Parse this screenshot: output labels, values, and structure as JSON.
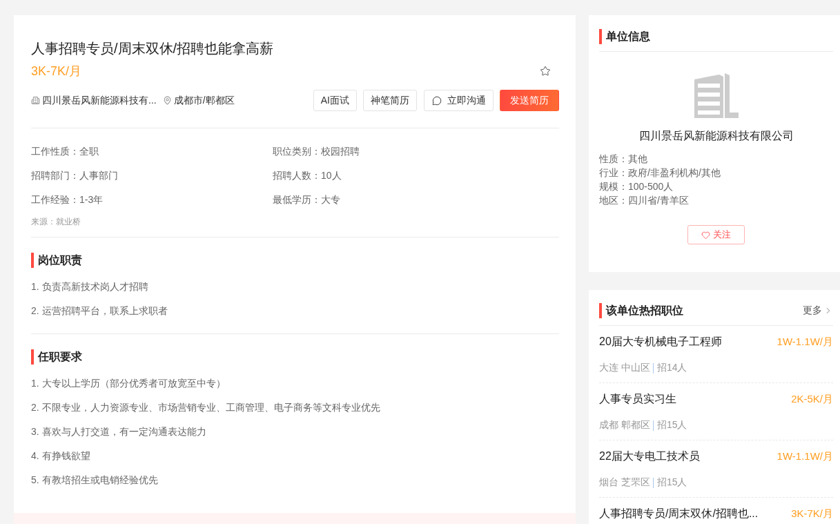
{
  "job": {
    "title": "人事招聘专员/周末双休/招聘也能拿高薪",
    "salary": "3K-7K/月",
    "favorited": false,
    "company": "四川景岳风新能源科技有...",
    "location": "成都市/郫都区",
    "actions": [
      {
        "label": "AI面试",
        "kind": "plain"
      },
      {
        "label": "神笔简历",
        "kind": "plain"
      },
      {
        "label": "立即沟通",
        "kind": "chat"
      },
      {
        "label": "发送简历",
        "kind": "primary"
      }
    ]
  },
  "details": [
    "工作性质：全职",
    "职位类别：校园招聘",
    "招聘部门：人事部门",
    "招聘人数：10人",
    "工作经验：1-3年",
    "最低学历：大专"
  ],
  "source": "来源：就业桥",
  "sections": [
    {
      "title": "岗位职责",
      "items": [
        "1. 负责高新技术岗人才招聘",
        "2. 运营招聘平台，联系上求职者"
      ]
    },
    {
      "title": "任职要求",
      "items": [
        "1. 大专以上学历（部分优秀者可放宽至中专）",
        "2. 不限专业，人力资源专业、市场营销专业、工商管理、电子商务等文科专业优先",
        "3. 喜欢与人打交道，有一定沟通表达能力",
        "4. 有挣钱欲望",
        "5. 有教培招生或电销经验优先"
      ]
    }
  ],
  "company_card": {
    "title": "单位信息",
    "name": "四川景岳风新能源科技有限公司",
    "facts": [
      "性质：其他",
      "行业：政府/非盈利机构/其他",
      "规模：100-500人",
      "地区：四川省/青羊区"
    ],
    "follow": {
      "label": "关注",
      "followed": false
    }
  },
  "hot_jobs": {
    "title": "该单位热招职位",
    "more": "更多",
    "jobs": [
      {
        "title": "20届大专机械电子工程师",
        "salary": "1W-1.1W/月",
        "location": "大连 中山区",
        "openings": "招14人"
      },
      {
        "title": "人事专员实习生",
        "salary": "2K-5K/月",
        "location": "成都 郫都区",
        "openings": "招15人"
      },
      {
        "title": "22届大专电工技术员",
        "salary": "1W-1.1W/月",
        "location": "烟台 芝罘区",
        "openings": "招15人"
      },
      {
        "title": "人事招聘专员/周末双休/招聘也...",
        "salary": "3K-7K/月"
      }
    ]
  }
}
